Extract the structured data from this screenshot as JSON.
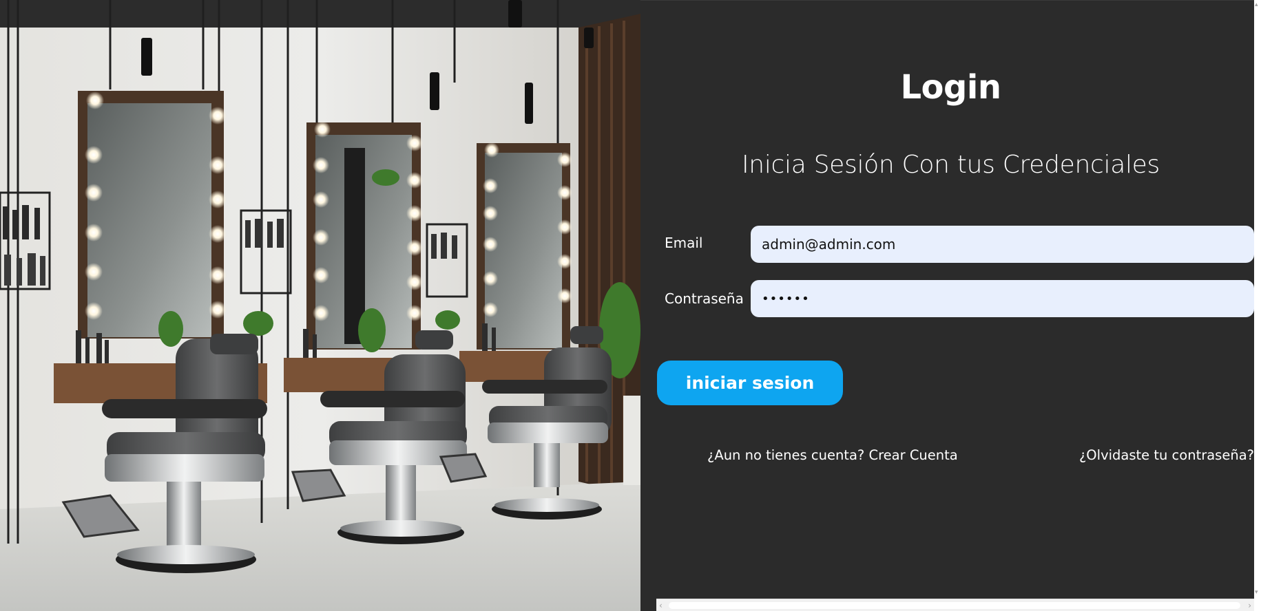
{
  "login": {
    "title": "Login",
    "subtitle": "Inicia Sesión Con tus Credenciales",
    "email_label": "Email",
    "email_value": "admin@admin.com",
    "password_label": "Contraseña",
    "password_value": "••••••",
    "submit_label": "iniciar sesion",
    "create_account_link": "¿Aun no tienes cuenta? Crear Cuenta",
    "forgot_password_link": "¿Olvidaste tu contraseña?"
  },
  "scrollbar": {
    "left_arrow": "‹",
    "right_arrow": "›",
    "up_arrow": "▴",
    "down_arrow": "▾"
  },
  "colors": {
    "panel_bg": "#2b2b2b",
    "input_bg": "#e8effd",
    "button_bg": "#0ea5f0",
    "text": "#ffffff"
  },
  "hero_image": {
    "subject": "barbershop-interior"
  }
}
